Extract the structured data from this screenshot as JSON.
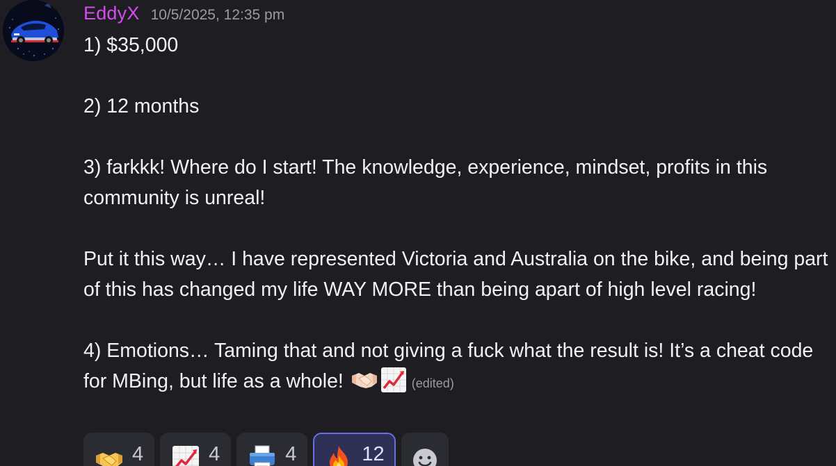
{
  "message": {
    "username": "EddyX",
    "timestamp": "10/5/2025, 12:35 pm",
    "username_color": "#d64cf0",
    "avatar_icon": "car-avatar",
    "paragraphs": [
      "1) $35,000",
      "2) 12 months",
      "3) farkkk! Where do I start! The knowledge, experience, mindset, profits in this community is unreal!",
      "Put it this way… I have represented Victoria and Australia on the bike, and being part of this has changed my life WAY MORE than being apart of high level racing!",
      "4) Emotions… Taming that and not giving a fuck what the result is! It’s a cheat code for MBing, but life as a whole!"
    ],
    "inline_emojis": [
      "handshake-emoji",
      "chart-increasing-emoji"
    ],
    "edited_label": "(edited)"
  },
  "reactions": [
    {
      "emoji": "handshake-emoji",
      "count": "4",
      "active": false
    },
    {
      "emoji": "chart-increasing-emoji",
      "count": "4",
      "active": false
    },
    {
      "emoji": "printer-emoji",
      "count": "4",
      "active": false
    },
    {
      "emoji": "fire-emoji",
      "count": "12",
      "active": true
    },
    {
      "emoji": "add-reaction-icon",
      "count": "",
      "active": false
    }
  ],
  "colors": {
    "background": "#1e1e22",
    "active_reaction_border": "#6671e6"
  }
}
